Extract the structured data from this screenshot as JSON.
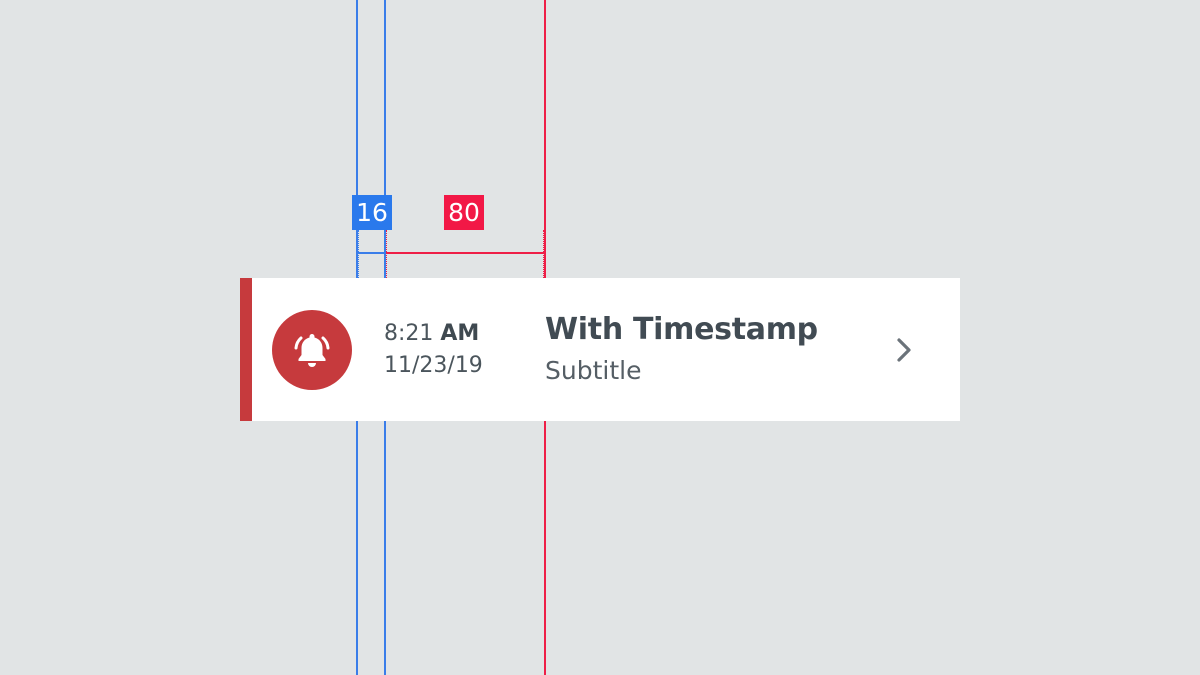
{
  "guides": {
    "left_spacing": "16",
    "column_width": "80",
    "colors": {
      "blue": "#2a79ec",
      "red": "#f21846"
    }
  },
  "list_item": {
    "accent_color": "#c63a3d",
    "icon": "bell-ringing-icon",
    "time": "8:21",
    "meridiem": "AM",
    "date": "11/23/19",
    "title": "With Timestamp",
    "subtitle": "Subtitle",
    "trailing_icon": "chevron-right-icon"
  }
}
